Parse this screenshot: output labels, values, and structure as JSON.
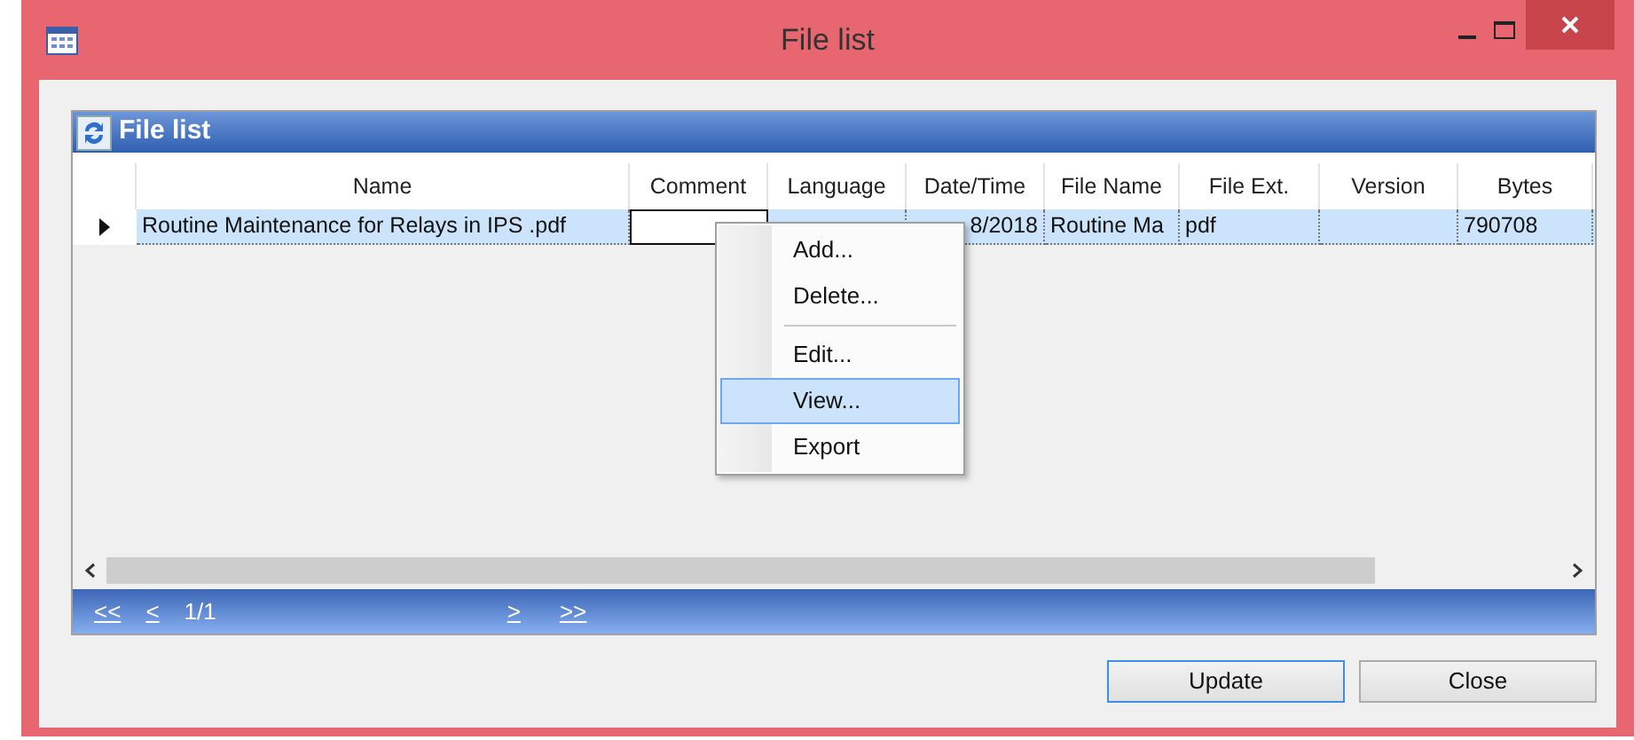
{
  "window": {
    "title": "File list"
  },
  "panel": {
    "title": "File list"
  },
  "table": {
    "columns": [
      "Name",
      "Comment",
      "Language",
      "Date/Time",
      "File Name",
      "File Ext.",
      "Version",
      "Bytes"
    ],
    "rows": [
      {
        "selected": true,
        "cells": [
          "Routine Maintenance for Relays in IPS .pdf",
          "",
          "",
          "8/2018",
          "Routine Ma",
          "pdf",
          "",
          "790708"
        ]
      }
    ]
  },
  "context_menu": {
    "items": [
      {
        "label": "Add...",
        "selected": false
      },
      {
        "label": "Delete...",
        "selected": false,
        "separator_after": true
      },
      {
        "label": "Edit...",
        "selected": false
      },
      {
        "label": "View...",
        "selected": true
      },
      {
        "label": "Export",
        "selected": false
      }
    ]
  },
  "pager": {
    "first": "<<",
    "prev": "<",
    "page": "1/1",
    "next": ">",
    "last": ">>"
  },
  "buttons": [
    {
      "label": "Update",
      "default": true
    },
    {
      "label": "Close",
      "default": false
    }
  ]
}
